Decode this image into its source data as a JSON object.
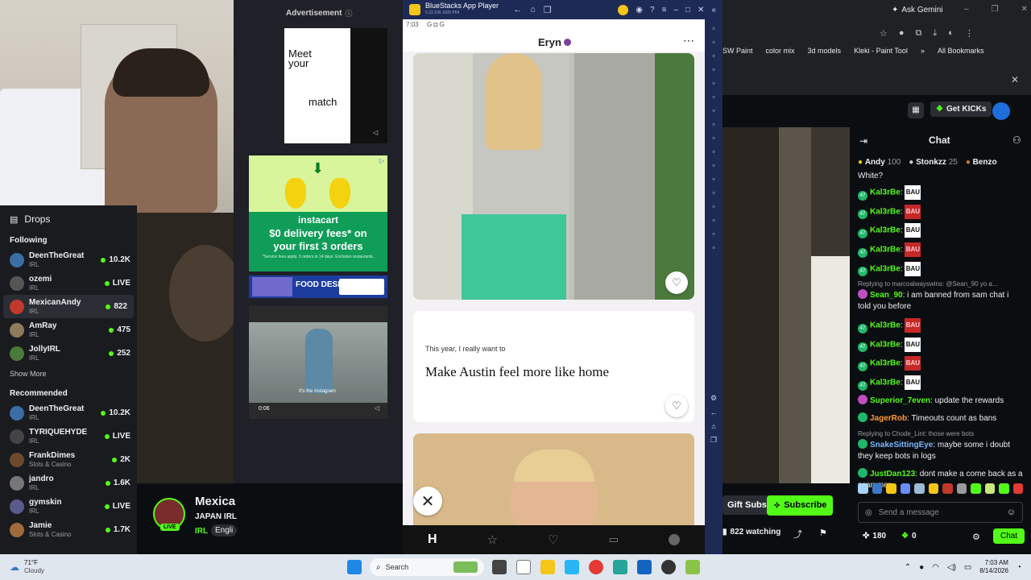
{
  "webcam": {},
  "ads": {
    "header": "Advertisement",
    "match": {
      "line1": "Meet",
      "line2": "your",
      "line3": "match"
    },
    "instacart": {
      "brand": "instacart",
      "headline": "$0 delivery fees* on your first 3 orders",
      "fineprint": "*Service fees apply. 3 orders in 14 days. Excludes restaurants."
    },
    "food": {
      "label": "FOOD DESERVES"
    },
    "video": {
      "caption": "It's the Instagram",
      "time": "0:06"
    }
  },
  "sidebar": {
    "drops_label": "Drops",
    "following_label": "Following",
    "following": [
      {
        "name": "DeenTheGreat",
        "category": "IRL",
        "viewers": "10.2K",
        "color": "#3a6ea5"
      },
      {
        "name": "ozemi",
        "category": "IRL",
        "viewers": "LIVE",
        "color": "#555"
      },
      {
        "name": "MexicanAndy",
        "category": "IRL",
        "viewers": "822",
        "color": "#c0392b",
        "active": true
      },
      {
        "name": "AmRay",
        "category": "IRL",
        "viewers": "475",
        "color": "#8e7a5c"
      },
      {
        "name": "JollyIRL",
        "category": "IRL",
        "viewers": "252",
        "color": "#4a7a3a"
      }
    ],
    "show_more": "Show More",
    "recommended_label": "Recommended",
    "recommended": [
      {
        "name": "DeenTheGreat",
        "category": "IRL",
        "viewers": "10.2K",
        "color": "#3a6ea5"
      },
      {
        "name": "TYRIQUEHYDE",
        "category": "IRL",
        "viewers": "LIVE",
        "color": "#444"
      },
      {
        "name": "FrankDimes",
        "category": "Slots & Casino",
        "viewers": "2K",
        "color": "#6b4a2f"
      },
      {
        "name": "jandro",
        "category": "IRL",
        "viewers": "1.6K",
        "color": "#777"
      },
      {
        "name": "gymskin",
        "category": "IRL",
        "viewers": "LIVE",
        "color": "#5a5a8a"
      },
      {
        "name": "Jamie",
        "category": "Slots & Casino",
        "viewers": "1.7K",
        "color": "#a06a3a"
      }
    ]
  },
  "stream_info": {
    "title": "Mexica",
    "subtitle": "JAPAN IRL",
    "category": "IRL",
    "language": "Engli",
    "live": "LIVE"
  },
  "bluestacks": {
    "title": "BlueStacks App Player",
    "version": "5.22.100.1005 P64"
  },
  "hinge": {
    "status_time": "7:03",
    "status_icons": "G ◘ G",
    "profile_name": "Eryn",
    "prompt_label": "This year, I really want to",
    "prompt_answer": "Make Austin feel more like home"
  },
  "browser": {
    "ask_gemini": "Ask Gemini",
    "bookmarks": [
      "SW Paint",
      "color mix",
      "3d models",
      "Kleki - Paint Tool"
    ],
    "all_bookmarks": "All Bookmarks"
  },
  "kick_header": {
    "get_kicks": "Get KICKs"
  },
  "chat": {
    "title": "Chat",
    "leaders": [
      {
        "name": "Andy",
        "count": "100"
      },
      {
        "name": "Stonkzz",
        "count": "25"
      },
      {
        "name": "Benzo",
        "count": ""
      }
    ],
    "first_line": "White?",
    "messages": [
      {
        "badge": "47",
        "user": "Kal3rBe",
        "emote": "BAU",
        "red": false
      },
      {
        "badge": "47",
        "user": "Kal3rBe",
        "emote": "BAU",
        "red": true
      },
      {
        "badge": "47",
        "user": "Kal3rBe",
        "emote": "BAU",
        "red": false
      },
      {
        "badge": "47",
        "user": "Kal3rBe",
        "emote": "BAU",
        "red": true
      },
      {
        "badge": "47",
        "user": "Kal3rBe",
        "emote": "BAU",
        "red": false
      }
    ],
    "reply1": "Replying to marcoalwayswins: @Sean_90 yo a...",
    "sean_user": "Sean_90",
    "sean_text": "i am banned from sam chat i told you before",
    "messages2": [
      {
        "badge": "47",
        "user": "Kal3rBe",
        "emote": "BAU",
        "red": true
      },
      {
        "badge": "47",
        "user": "Kal3rBe",
        "emote": "BAU",
        "red": false
      },
      {
        "badge": "47",
        "user": "Kal3rBe",
        "emote": "BAU",
        "red": true
      },
      {
        "badge": "47",
        "user": "Kal3rBe",
        "emote": "BAU",
        "red": false
      }
    ],
    "superior_user": "Superior_7even",
    "superior_text": "update the rewards",
    "jager_user": "JagerRob",
    "jager_text": "Timeouts count as bans",
    "reply2": "Replying to Chode_Lint: those were bots",
    "snake_user": "SnakeSittingEye",
    "snake_text": "maybe some i doubt they keep bots in logs",
    "justdan_user": "JustDan123",
    "justdan_text": "dont make a come back as a scammer",
    "send_placeholder": "Send a message",
    "points": "180",
    "points2": "0",
    "chat_button": "Chat"
  },
  "bottom_bar": {
    "gift_subs": "Gift Subs",
    "subscribe": "Subscribe",
    "watching": "822 watching"
  },
  "taskbar": {
    "temp": "71°F",
    "weather": "Cloudy",
    "search": "Search",
    "time": "7:03 AM",
    "date": "8/14/2026"
  }
}
